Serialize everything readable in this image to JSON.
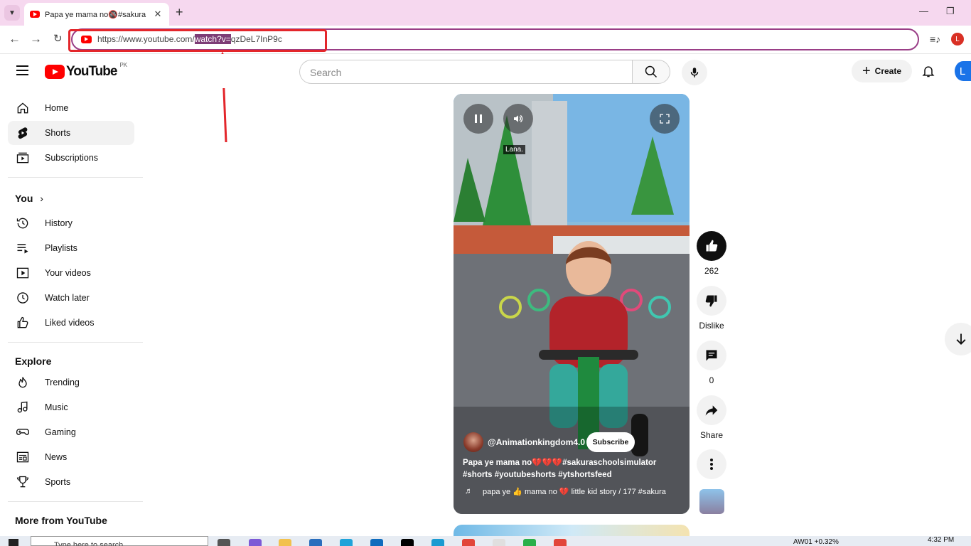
{
  "browser": {
    "tab_title": "Papa ye mama no🚳#sakura",
    "url_prefix": "https://www.youtube.com/",
    "url_highlight": "watch?v=",
    "url_suffix": "qzDeL7InP9c",
    "profile_initial": "L"
  },
  "header": {
    "logo_text": "YouTube",
    "region": "PK",
    "search_placeholder": "Search",
    "create_label": "Create",
    "avatar_initial": "L"
  },
  "sidebar": {
    "main": [
      {
        "label": "Home",
        "icon": "home-icon"
      },
      {
        "label": "Shorts",
        "icon": "shorts-icon"
      },
      {
        "label": "Subscriptions",
        "icon": "subscriptions-icon"
      }
    ],
    "you_heading": "You",
    "you": [
      {
        "label": "History",
        "icon": "history-icon"
      },
      {
        "label": "Playlists",
        "icon": "playlists-icon"
      },
      {
        "label": "Your videos",
        "icon": "your-videos-icon"
      },
      {
        "label": "Watch later",
        "icon": "watch-later-icon"
      },
      {
        "label": "Liked videos",
        "icon": "liked-videos-icon"
      }
    ],
    "explore_heading": "Explore",
    "explore": [
      {
        "label": "Trending",
        "icon": "trending-icon"
      },
      {
        "label": "Music",
        "icon": "music-icon"
      },
      {
        "label": "Gaming",
        "icon": "gaming-icon"
      },
      {
        "label": "News",
        "icon": "news-icon"
      },
      {
        "label": "Sports",
        "icon": "sports-icon"
      }
    ],
    "more_heading": "More from YouTube"
  },
  "short": {
    "overlay_caption": "Lana.",
    "channel": "@Animationkingdom4.0",
    "subscribe_label": "Subscribe",
    "description": "Papa ye mama no💔💔💔#sakuraschoolsimulator #shorts #youtubeshorts #ytshortsfeed",
    "music": "papa ye 👍 mama no 💔 little kid story / 177 #sakura"
  },
  "actions": {
    "likes": "262",
    "dislike_label": "Dislike",
    "comments": "0",
    "share_label": "Share"
  },
  "taskbar": {
    "search_placeholder": "Type here to search",
    "stock": "AW01  +0.32%",
    "time": "4:32 PM"
  },
  "colors": {
    "annotation_red": "#e3262b",
    "yt_red": "#ff0000",
    "tab_bar": "#f6d8ef",
    "url_highlight": "#7d3d76"
  }
}
